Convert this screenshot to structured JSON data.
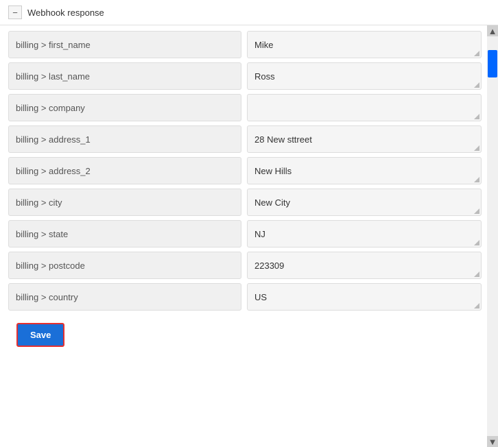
{
  "header": {
    "toggle_label": "−",
    "title": "Webhook response"
  },
  "fields": [
    {
      "label": "billing > first_name",
      "value": "Mike"
    },
    {
      "label": "billing > last_name",
      "value": "Ross"
    },
    {
      "label": "billing > company",
      "value": ""
    },
    {
      "label": "billing > address_1",
      "value": "28 New sttreet"
    },
    {
      "label": "billing > address_2",
      "value": "New Hills"
    },
    {
      "label": "billing > city",
      "value": "New City"
    },
    {
      "label": "billing > state",
      "value": "NJ"
    },
    {
      "label": "billing > postcode",
      "value": "223309"
    },
    {
      "label": "billing > country",
      "value": "US"
    }
  ],
  "save_button": {
    "label": "Save"
  },
  "scrollbar": {
    "up_arrow": "▲",
    "down_arrow": "▼"
  }
}
